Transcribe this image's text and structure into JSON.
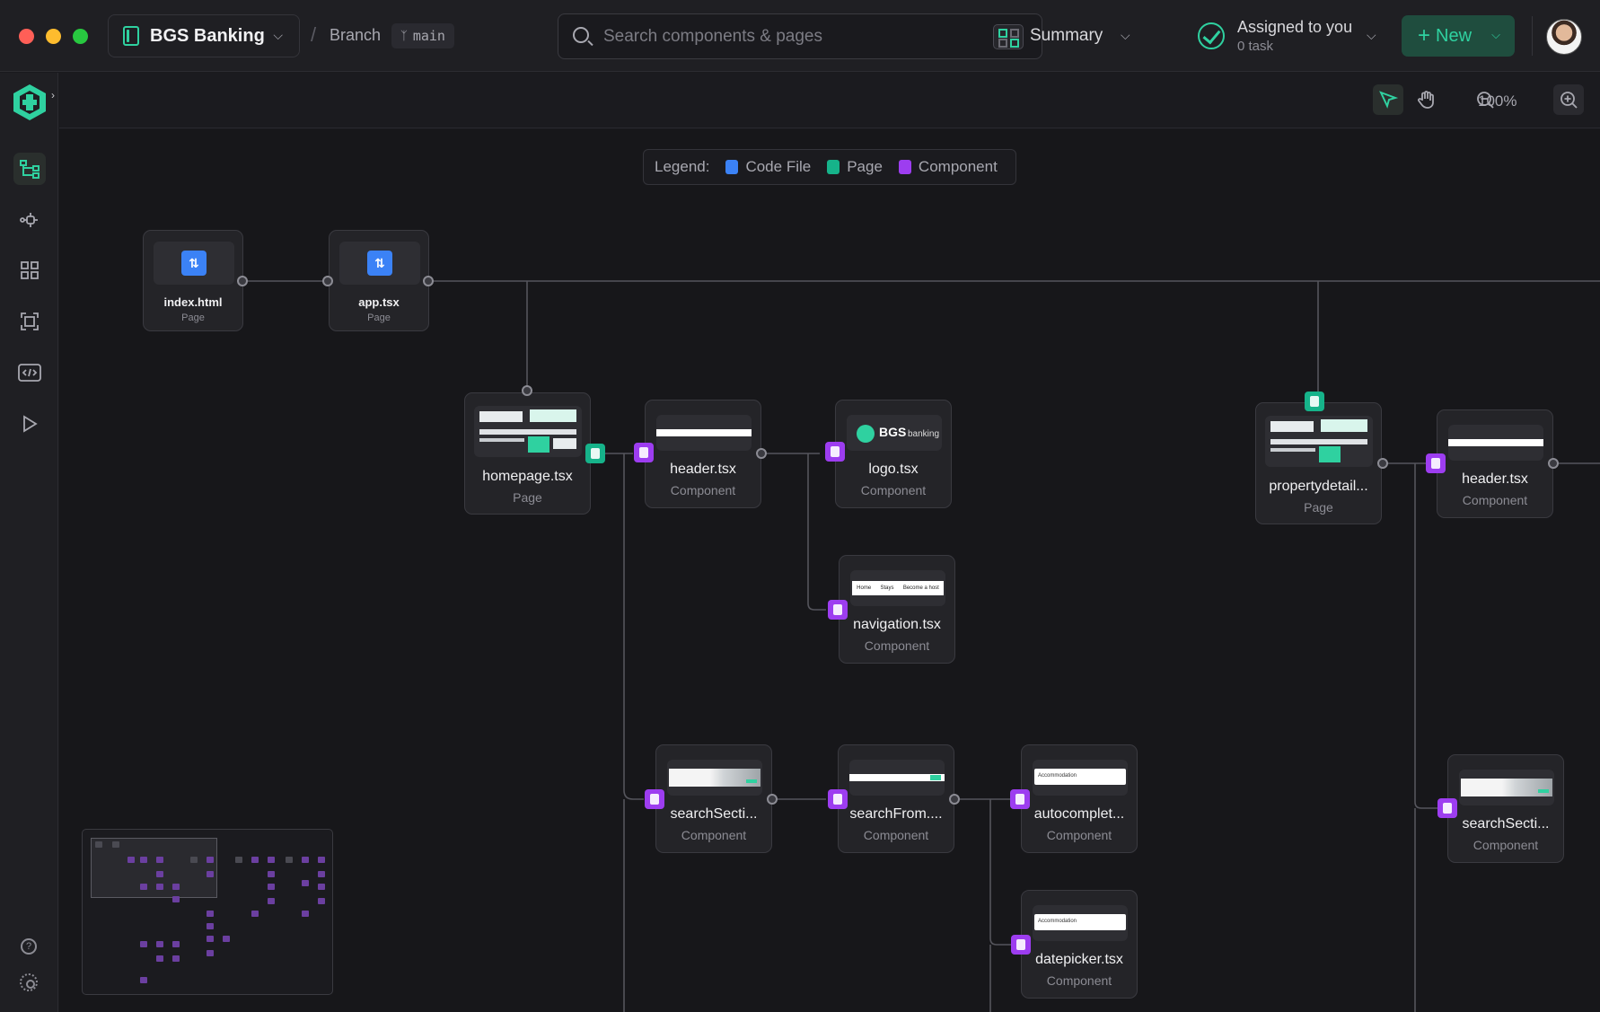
{
  "project": {
    "name": "BGS Banking"
  },
  "branch": {
    "label": "Branch",
    "name": "main"
  },
  "search": {
    "placeholder": "Search components & pages"
  },
  "summary": {
    "label": "Summary"
  },
  "assigned": {
    "title": "Assigned to you",
    "subtitle": "0 task"
  },
  "new_button": {
    "label": "New"
  },
  "zoom": {
    "level": "100%"
  },
  "legend": {
    "label": "Legend:",
    "items": [
      {
        "label": "Code File",
        "color": "#3b82f6"
      },
      {
        "label": "Page",
        "color": "#16b38a"
      },
      {
        "label": "Component",
        "color": "#9d3df0"
      }
    ]
  },
  "nodes": {
    "index": {
      "title": "index.html",
      "type": "Page"
    },
    "app": {
      "title": "app.tsx",
      "type": "Page"
    },
    "homepage": {
      "title": "homepage.tsx",
      "type": "Page"
    },
    "header": {
      "title": "header.tsx",
      "type": "Component"
    },
    "logo": {
      "title": "logo.tsx",
      "type": "Component",
      "brand_text": "BGS",
      "brand_sub": "banking"
    },
    "navigation": {
      "title": "navigation.tsx",
      "type": "Component",
      "nav_items": [
        "Home",
        "Stays",
        "Become a host"
      ]
    },
    "searchSection": {
      "title": "searchSecti...",
      "type": "Component"
    },
    "searchForm": {
      "title": "searchFrom....",
      "type": "Component"
    },
    "autocomplete": {
      "title": "autocomplet...",
      "type": "Component",
      "thumb_text": "Accommodation"
    },
    "datepicker": {
      "title": "datepicker.tsx",
      "type": "Component",
      "thumb_text": "Accommodation"
    },
    "propertydetail": {
      "title": "propertydetail...",
      "type": "Page"
    },
    "header2": {
      "title": "header.tsx",
      "type": "Component"
    },
    "searchSection2": {
      "title": "searchSecti...",
      "type": "Component"
    }
  },
  "colors": {
    "accent": "#2fd1a0",
    "component": "#9d3df0",
    "page": "#16b38a",
    "code_file": "#3b82f6"
  },
  "icons": {
    "sidebar": [
      "flow-icon",
      "components-icon",
      "grid-icon",
      "frame-icon",
      "code-icon",
      "play-icon"
    ],
    "footer": [
      "help-icon",
      "settings-icon"
    ]
  }
}
